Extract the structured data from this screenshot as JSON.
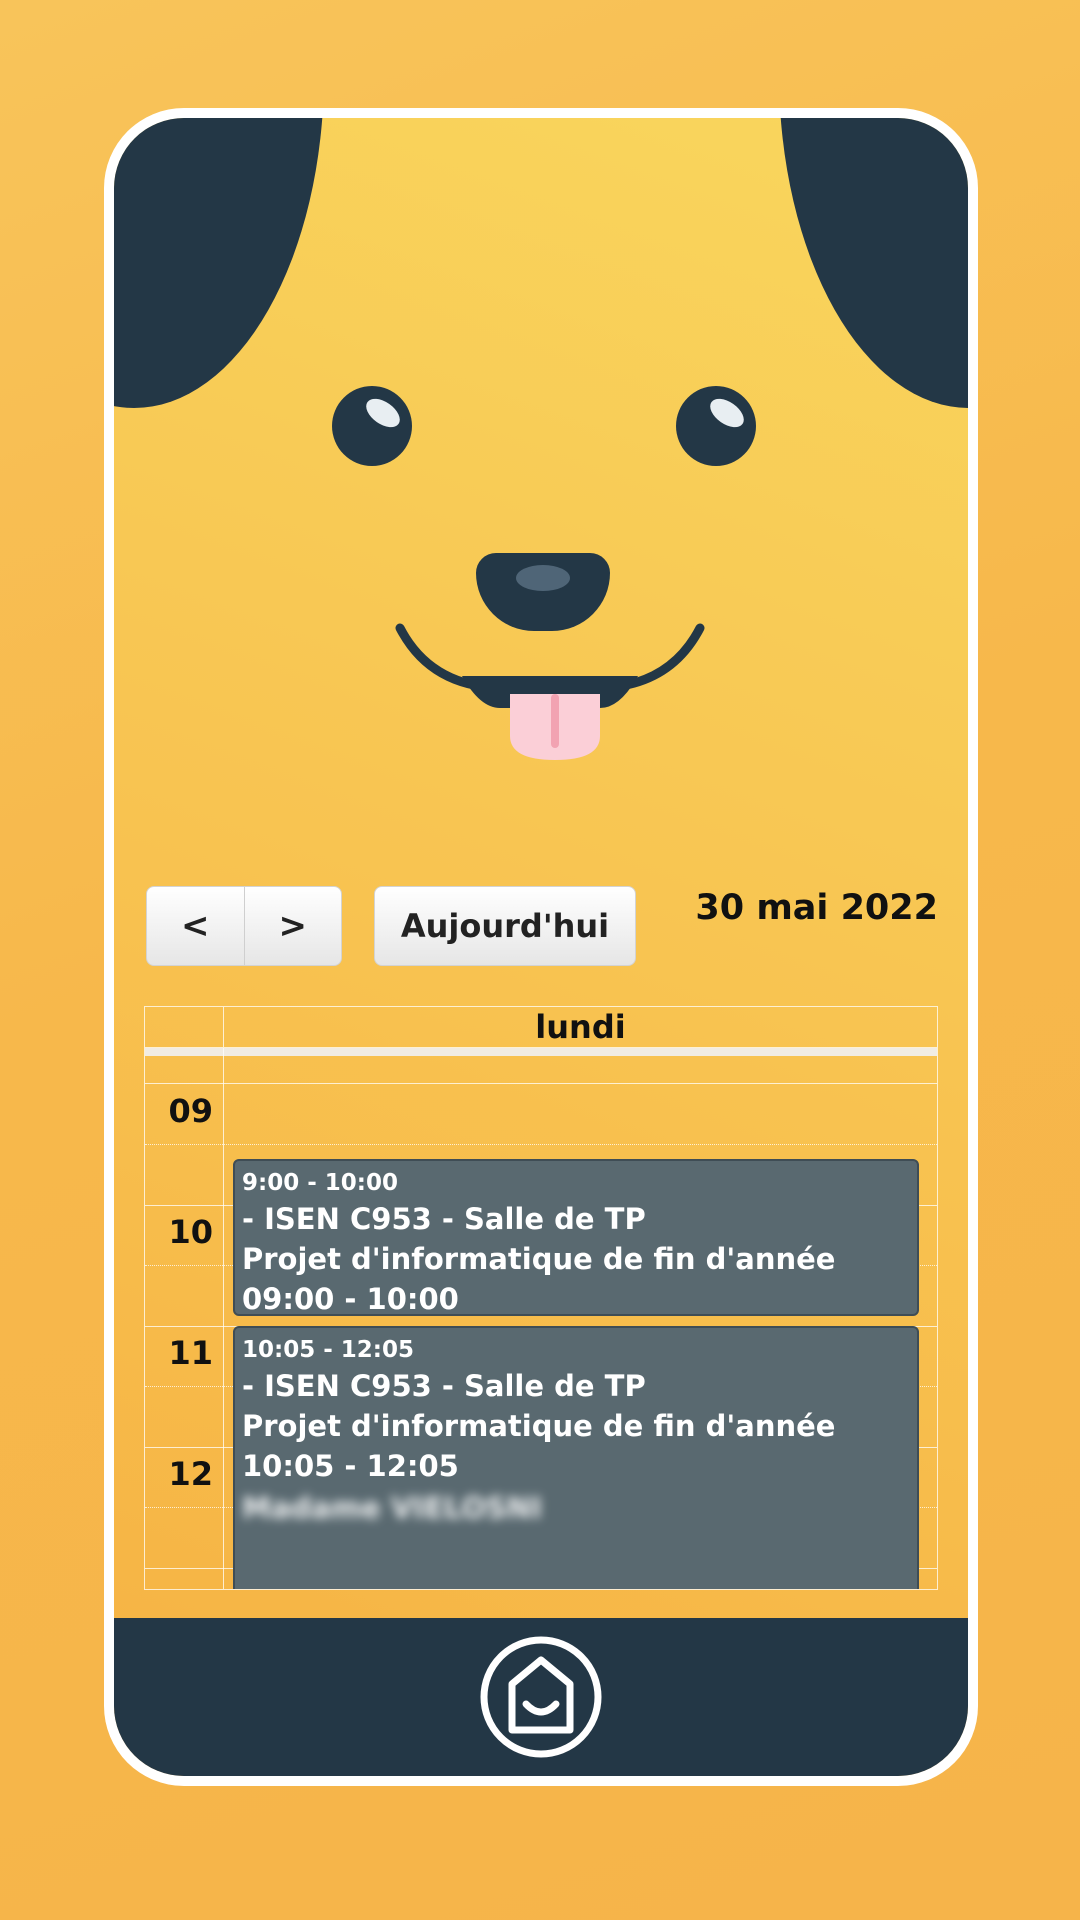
{
  "colors": {
    "background": "#f7b84b",
    "face_dark": "#233746",
    "tongue": "#fbcfd7",
    "event_bg": "#596970"
  },
  "face": {
    "icon": "dog-face-icon"
  },
  "toolbar": {
    "prev_label": "<",
    "next_label": ">",
    "today_label": "Aujourd'hui",
    "title": "30 mai 2022"
  },
  "calendar": {
    "day_header": "lundi",
    "hours": [
      "09",
      "10",
      "11",
      "12"
    ],
    "events": [
      {
        "time": "9:00 - 10:00",
        "location": "- ISEN C953 - Salle de TP",
        "title": "Projet d'informatique de fin d'année",
        "time_detail": "09:00 - 10:00"
      },
      {
        "time": "10:05 - 12:05",
        "location": "- ISEN C953 - Salle de TP",
        "title": "Projet d'informatique de fin d'année",
        "time_detail": "10:05 - 12:05",
        "teacher": "Madame VIELOSNI"
      }
    ]
  },
  "bottom_nav": {
    "home_icon": "home-icon"
  }
}
